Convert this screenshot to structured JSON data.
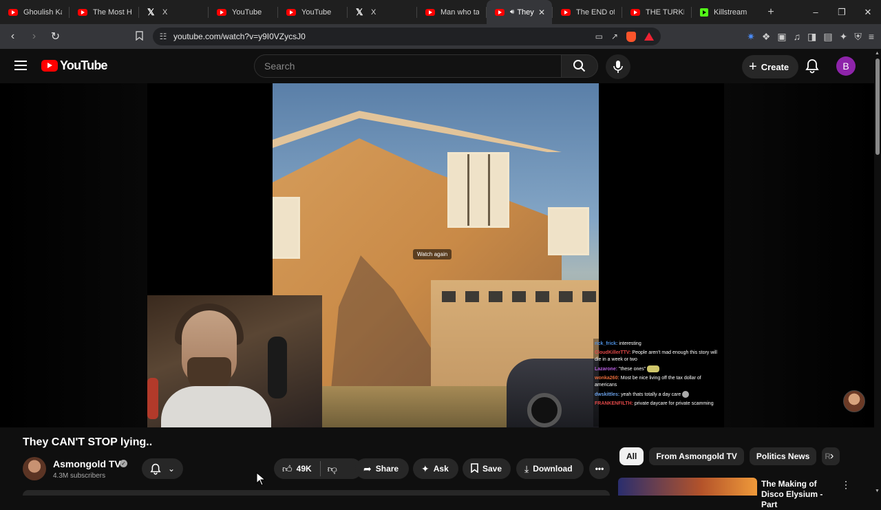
{
  "browser": {
    "tabs": [
      {
        "label": "Ghoulish Kar",
        "icon": "youtube-favicon",
        "active": false
      },
      {
        "label": "The Most Ha",
        "icon": "youtube-favicon",
        "active": false
      },
      {
        "label": "X",
        "icon": "x-favicon",
        "active": false
      },
      {
        "label": "YouTube",
        "icon": "youtube-favicon",
        "active": false
      },
      {
        "label": "YouTube",
        "icon": "youtube-favicon",
        "active": false
      },
      {
        "label": "X",
        "icon": "x-favicon",
        "active": false
      },
      {
        "label": "Man who tau",
        "icon": "youtube-favicon",
        "active": false
      },
      {
        "label": "They",
        "icon": "youtube-favicon",
        "active": true
      },
      {
        "label": "The END of",
        "icon": "youtube-favicon",
        "active": false
      },
      {
        "label": "THE TURKEY",
        "icon": "youtube-favicon",
        "active": false
      },
      {
        "label": "Killstream",
        "icon": "kick-favicon",
        "active": false
      }
    ],
    "url": "youtube.com/watch?v=y9I0VZycsJ0",
    "window_controls": {
      "minimize": "–",
      "restore": "❐",
      "close": "✕"
    }
  },
  "youtube": {
    "logo_text": "YouTube",
    "search_placeholder": "Search",
    "create_label": "Create",
    "avatar_letter": "B",
    "player": {
      "overlay_text": "Watch again",
      "chat": [
        {
          "user": "rick_frick:",
          "text": "interesting",
          "color": "#4d8fe0"
        },
        {
          "user": "CloudKillerTTV:",
          "text": "People aren't mad enough this story will die in a week or two",
          "color": "#e04848"
        },
        {
          "user": "Lazarone:",
          "text": "\"these ones\"",
          "color": "#b75ee0",
          "emote": "square"
        },
        {
          "user": "wonka260:",
          "text": "Most be nice living off the tax dollar of americans",
          "color": "#e86a3a"
        },
        {
          "user": "dwskittles:",
          "text": "yeah thats totally a day care",
          "color": "#6aa0e8",
          "emote": "round"
        },
        {
          "user": "FRANKENFILTH:",
          "text": "private daycare for private scamming",
          "color": "#e04848"
        }
      ]
    },
    "video": {
      "title": "They CAN'T STOP lying..",
      "channel_name": "Asmongold TV",
      "subscribers": "4.3M subscribers",
      "likes": "49K",
      "share_label": "Share",
      "ask_label": "Ask",
      "save_label": "Save",
      "download_label": "Download"
    },
    "chips": [
      "All",
      "From Asmongold TV",
      "Politics News",
      "R"
    ],
    "recommendation": {
      "title": "The Making of Disco Elysium - Part"
    }
  }
}
